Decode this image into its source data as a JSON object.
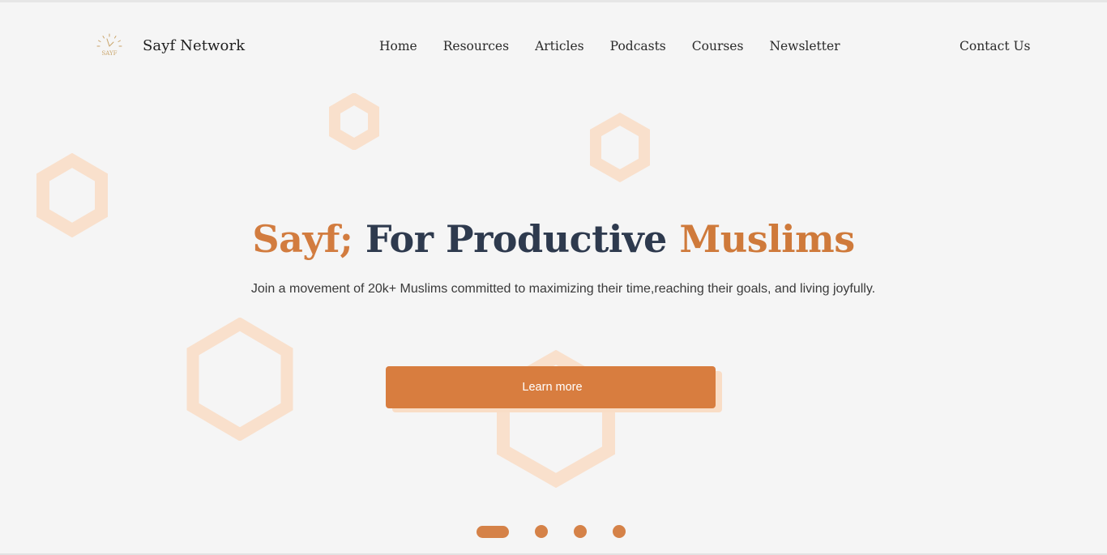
{
  "brand": {
    "name": "Sayf Network",
    "logo_text": "SAYF"
  },
  "nav": {
    "items": [
      {
        "label": "Home"
      },
      {
        "label": "Resources"
      },
      {
        "label": "Articles"
      },
      {
        "label": "Podcasts"
      },
      {
        "label": "Courses"
      },
      {
        "label": "Newsletter"
      }
    ],
    "contact_label": "Contact Us"
  },
  "hero": {
    "title_part1": "Sayf;",
    "title_part2": " For Productive ",
    "title_part3": "Muslims",
    "subtitle": "Join a movement of 20k+ Muslims committed to maximizing their time,reaching their goals, and living joyfully.",
    "cta_label": "Learn more"
  },
  "slider": {
    "slide_count": 4,
    "active_index": 0
  },
  "colors": {
    "accent": "#d87d3f",
    "title": "#2e3a4e",
    "hexagon": "#f9e0cc",
    "background": "#f5f5f5"
  }
}
